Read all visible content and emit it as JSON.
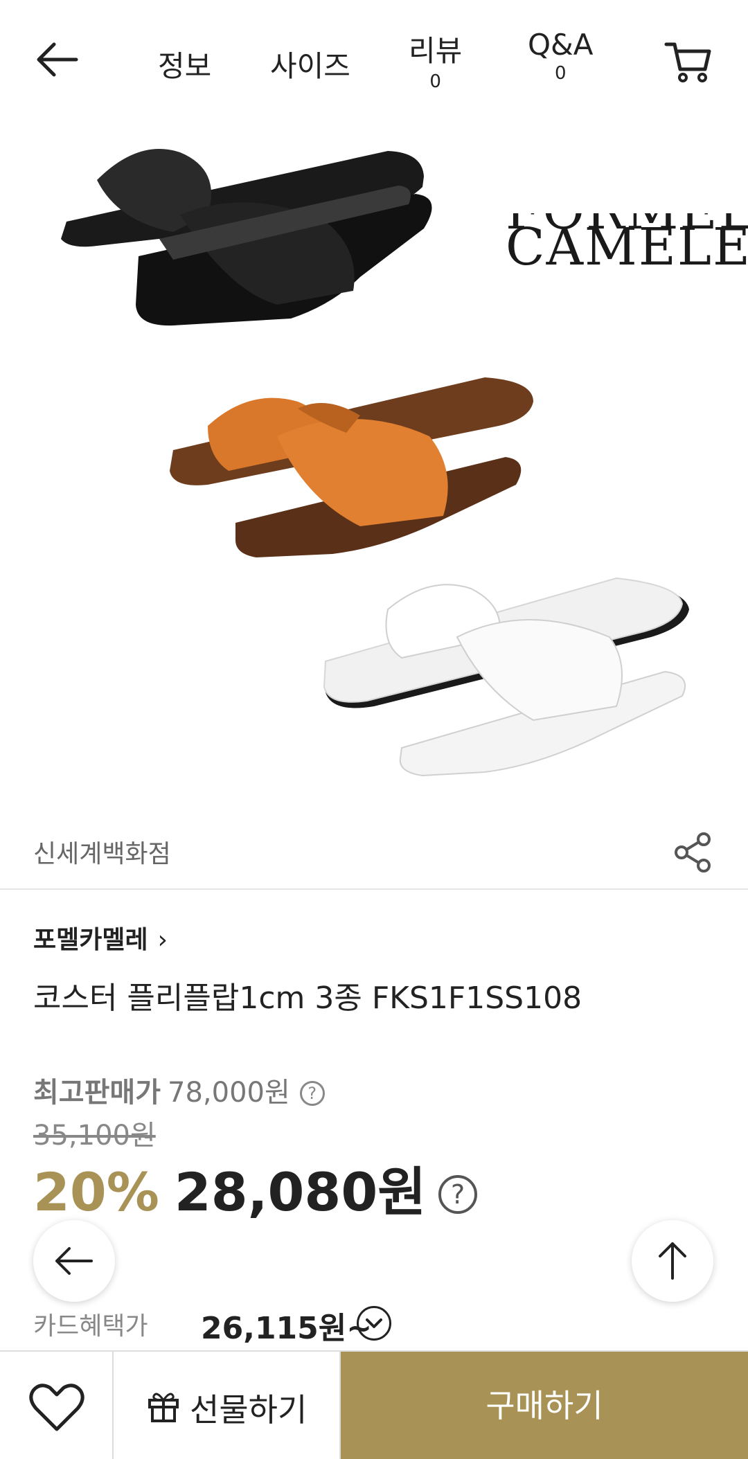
{
  "header": {
    "tabs": [
      {
        "label": "정보",
        "count": ""
      },
      {
        "label": "사이즈",
        "count": ""
      },
      {
        "label": "리뷰",
        "count": "0"
      },
      {
        "label": "Q&A",
        "count": "0"
      }
    ]
  },
  "hero": {
    "brand_logo_top": "FORMEL",
    "brand_logo_bottom": "CAMELE",
    "products": [
      {
        "color_name": "black",
        "upper": "#1c1c1c",
        "sole": "#111111"
      },
      {
        "color_name": "brown",
        "upper": "#d9782a",
        "sole": "#7a4422"
      },
      {
        "color_name": "white",
        "upper": "#f2f2f2",
        "sole": "#1a1a1a"
      }
    ]
  },
  "seller": {
    "name": "신세계백화점"
  },
  "product": {
    "brand": "포멜카멜레",
    "title": "코스터 플리플랍1cm 3종 FKS1F1SS108"
  },
  "pricing": {
    "best_label": "최고판매가",
    "best_price": "78,000원",
    "original_price": "35,100원",
    "discount": "20%",
    "final_price": "28,080원",
    "card_label": "카드혜택가",
    "card_price": "26,115원~"
  },
  "bottom_bar": {
    "gift_label": "선물하기",
    "buy_label": "구매하기"
  },
  "colors": {
    "accent": "#a89256",
    "lens_button": "#666666"
  }
}
